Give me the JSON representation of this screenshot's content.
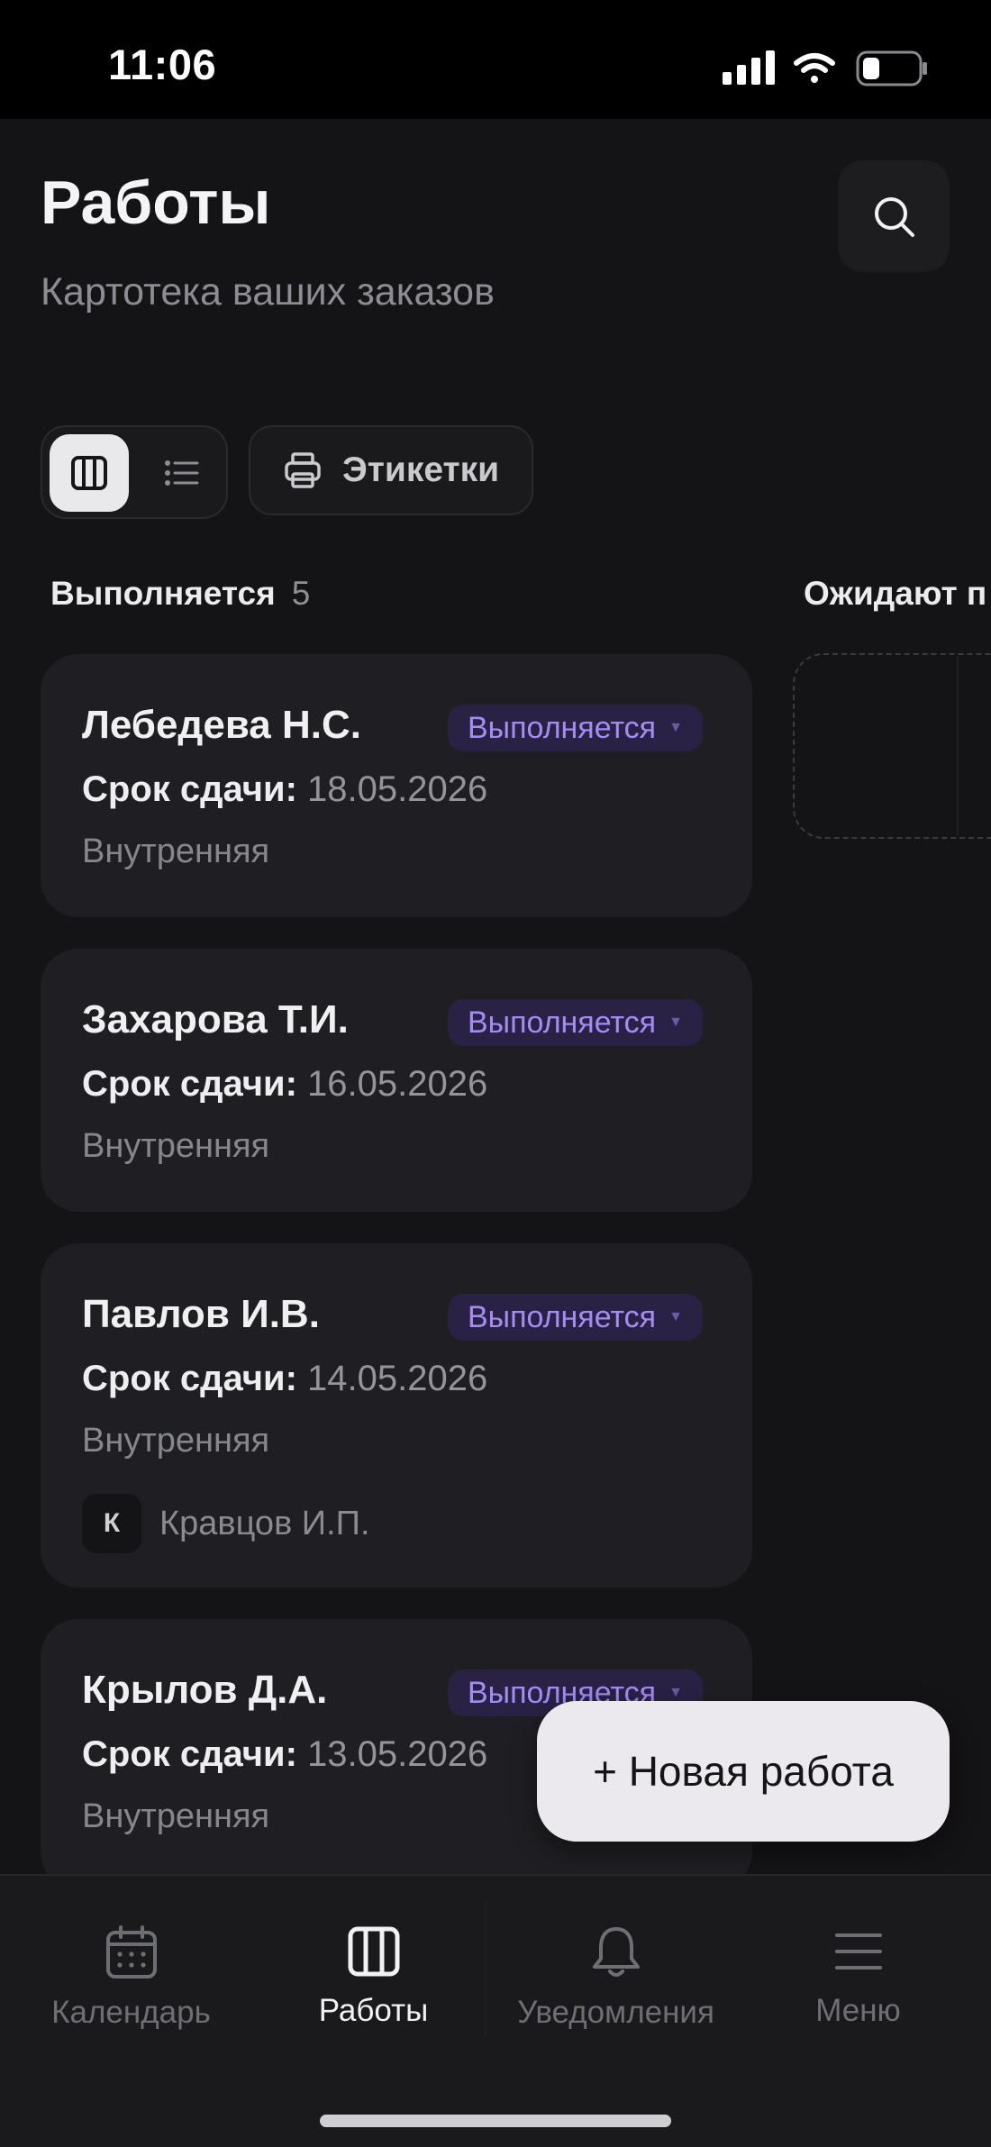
{
  "status_bar": {
    "time": "11:06"
  },
  "header": {
    "title": "Работы",
    "subtitle": "Картотека ваших заказов"
  },
  "toolbar": {
    "view_board": "board-view",
    "view_list": "list-view",
    "labels_button": "Этикетки"
  },
  "columns": [
    {
      "title": "Выполняется",
      "count": "5"
    },
    {
      "title": "Ожидают п"
    }
  ],
  "cards": [
    {
      "name": "Лебедева Н.С.",
      "status": "Выполняется",
      "due_label": "Срок сдачи:",
      "due_value": "18.05.2026",
      "type": "Внутренняя"
    },
    {
      "name": "Захарова Т.И.",
      "status": "Выполняется",
      "due_label": "Срок сдачи:",
      "due_value": "16.05.2026",
      "type": "Внутренняя"
    },
    {
      "name": "Павлов И.В.",
      "status": "Выполняется",
      "due_label": "Срок сдачи:",
      "due_value": "14.05.2026",
      "type": "Внутренняя",
      "assignee_initial": "К",
      "assignee_name": "Кравцов И.П."
    },
    {
      "name": "Крылов Д.А.",
      "status": "Выполняется",
      "due_label": "Срок сдачи:",
      "due_value": "13.05.2026",
      "type": "Внутренняя"
    }
  ],
  "fab": {
    "label": "+ Новая работа"
  },
  "bottom_nav": [
    {
      "label": "Календарь",
      "icon": "calendar-icon"
    },
    {
      "label": "Работы",
      "icon": "columns-icon",
      "active": true
    },
    {
      "label": "Уведомления",
      "icon": "bell-icon"
    },
    {
      "label": "Меню",
      "icon": "menu-icon"
    }
  ],
  "colors": {
    "background": "#141416",
    "card": "#1f1f23",
    "badge_bg": "#2a2245",
    "badge_text": "#a48cf3",
    "fab": "#ebe9ee"
  }
}
